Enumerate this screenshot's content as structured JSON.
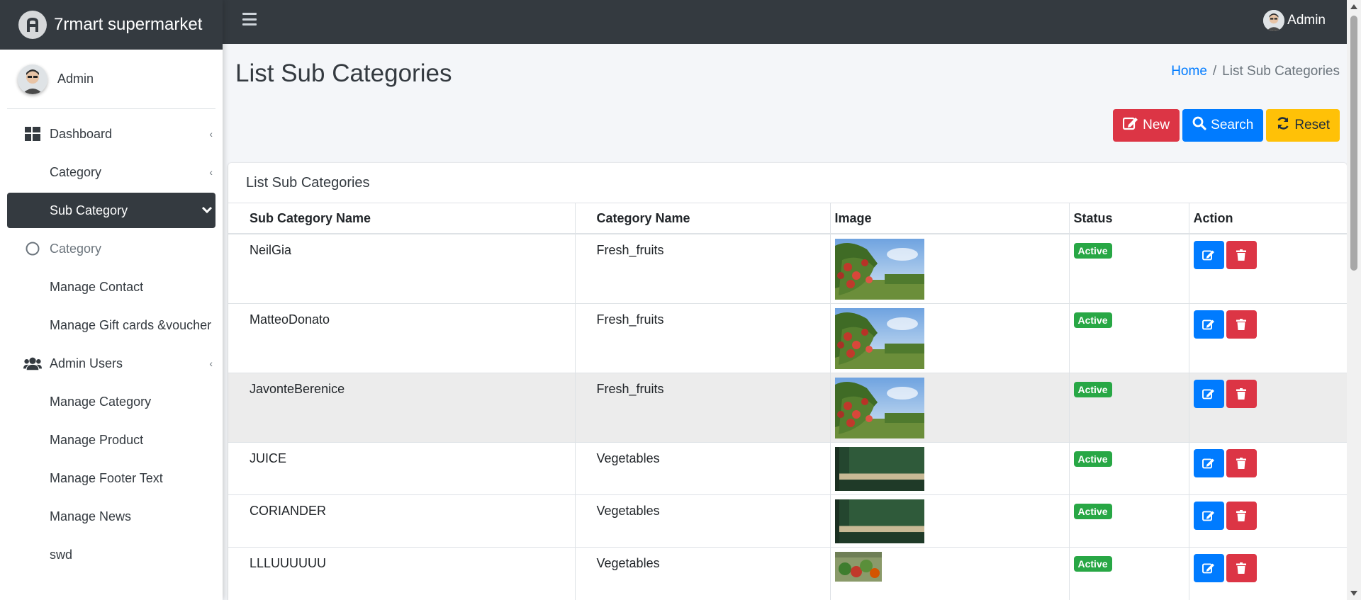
{
  "brand": {
    "name": "7rmart supermarket"
  },
  "sidebar": {
    "user": "Admin",
    "items": [
      {
        "label": "Dashboard"
      },
      {
        "label": "Category"
      },
      {
        "label": "Sub Category"
      },
      {
        "label": "Category"
      },
      {
        "label": "Manage Contact"
      },
      {
        "label": "Manage Gift cards &voucher"
      },
      {
        "label": "Admin Users"
      },
      {
        "label": "Manage Category"
      },
      {
        "label": "Manage Product"
      },
      {
        "label": "Manage Footer Text"
      },
      {
        "label": "Manage News"
      },
      {
        "label": "swd"
      }
    ]
  },
  "topbar": {
    "user": "Admin"
  },
  "page": {
    "title": "List Sub Categories",
    "breadcrumb": {
      "home": "Home",
      "current": "List Sub Categories"
    }
  },
  "actions": {
    "new": "New",
    "search": "Search",
    "reset": "Reset"
  },
  "card": {
    "title": "List Sub Categories"
  },
  "table": {
    "headers": [
      "Sub Category Name",
      "Category Name",
      "Image",
      "Status",
      "Action"
    ],
    "rows": [
      {
        "name": "NeilGia",
        "category": "Fresh_fruits",
        "status": "Active",
        "image": "apple-tree"
      },
      {
        "name": "MatteoDonato",
        "category": "Fresh_fruits",
        "status": "Active",
        "image": "apple-tree"
      },
      {
        "name": "JavonteBerenice",
        "category": "Fresh_fruits",
        "status": "Active",
        "image": "apple-tree"
      },
      {
        "name": "JUICE",
        "category": "Vegetables",
        "status": "Active",
        "image": "green-wall"
      },
      {
        "name": "CORIANDER",
        "category": "Vegetables",
        "status": "Active",
        "image": "green-wall"
      },
      {
        "name": "LLLUUUUUU",
        "category": "Vegetables",
        "status": "Active",
        "image": "vegetables"
      }
    ]
  },
  "colors": {
    "sidebar_active": "#343a40",
    "topbar": "#343a40",
    "new_button": "#dc3545",
    "search_button": "#007bff",
    "reset_button": "#ffc107",
    "status_active": "#28a745"
  }
}
